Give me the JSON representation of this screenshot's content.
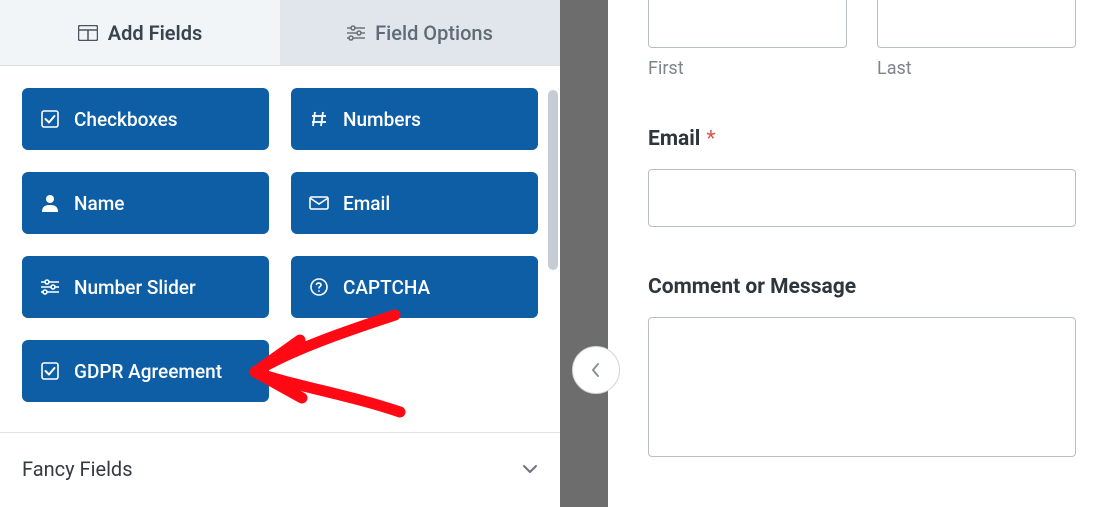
{
  "tabs": {
    "add_fields": "Add Fields",
    "field_options": "Field Options"
  },
  "fields": {
    "checkboxes": "Checkboxes",
    "numbers": "Numbers",
    "name": "Name",
    "email": "Email",
    "number_slider": "Number Slider",
    "captcha": "CAPTCHA",
    "gdpr": "GDPR Agreement"
  },
  "sections": {
    "fancy": "Fancy Fields"
  },
  "preview": {
    "first_label": "First",
    "last_label": "Last",
    "email_label": "Email",
    "required_mark": "*",
    "comment_label": "Comment or Message"
  }
}
